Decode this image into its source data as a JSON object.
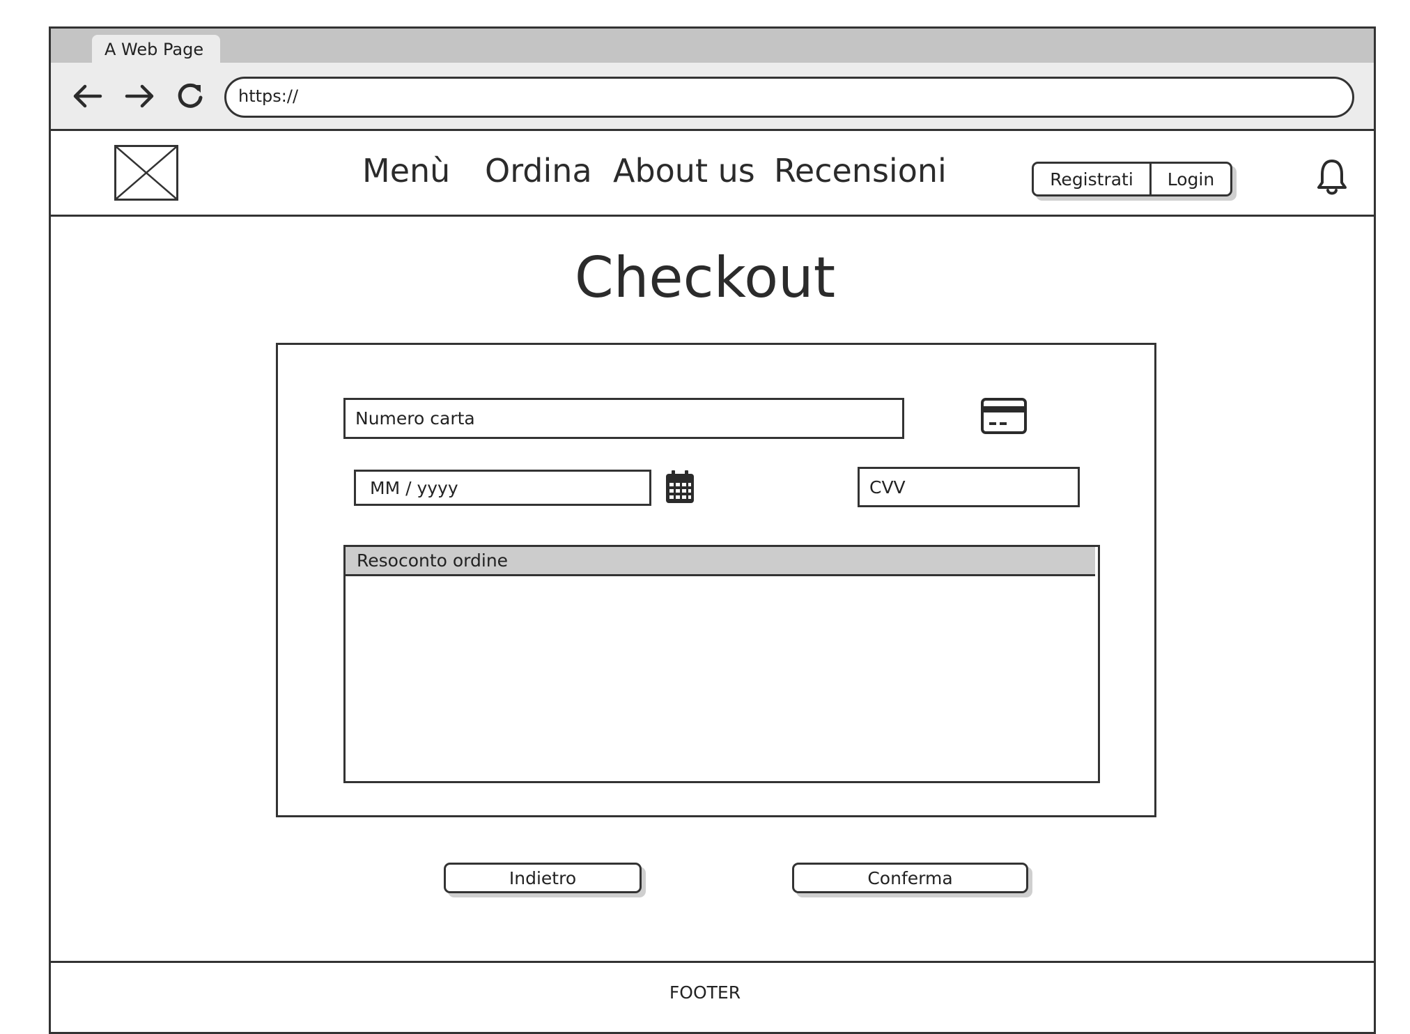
{
  "browser": {
    "tab_title": "A Web Page",
    "url": "https://",
    "back_icon": "arrow-left-icon",
    "forward_icon": "arrow-right-icon",
    "reload_icon": "reload-icon"
  },
  "header": {
    "logo": "image-placeholder-icon",
    "nav": [
      "Menù",
      "Ordina",
      "About us",
      "Recensioni"
    ],
    "register_label": "Registrati",
    "login_label": "Login",
    "notification_icon": "bell-icon"
  },
  "main": {
    "title": "Checkout",
    "card_number_placeholder": "Numero carta",
    "card_icon": "credit-card-icon",
    "expiry_placeholder": "MM / yyyy",
    "calendar_icon": "calendar-icon",
    "cvv_placeholder": "CVV",
    "summary_title": "Resoconto ordine",
    "back_label": "Indietro",
    "confirm_label": "Conferma"
  },
  "footer": {
    "text": "FOOTER"
  }
}
